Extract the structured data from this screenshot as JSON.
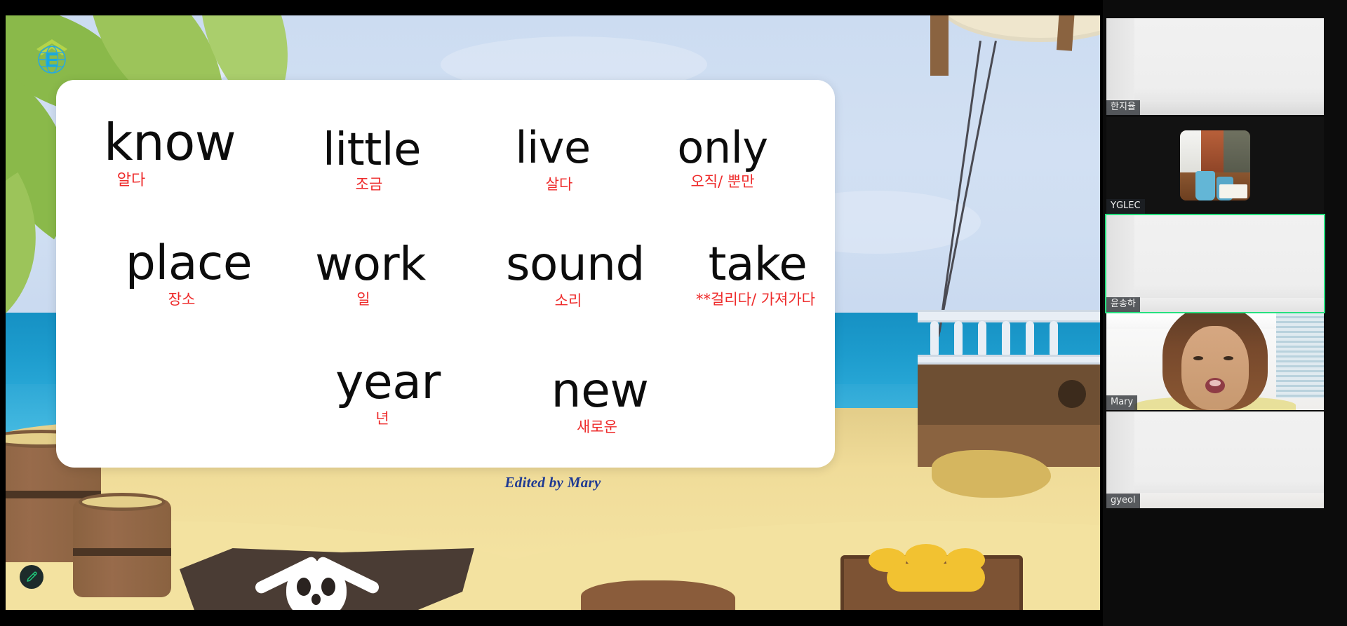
{
  "meeting": {
    "layout": "shared-screen-with-filmstrip",
    "active_speaker_border_color": "#26e07f",
    "annotate_button_label": "Annotate",
    "annotate_icon": "pencil-icon"
  },
  "slide": {
    "title_logo_alt": "globe-e-logo",
    "credit": "Edited by Mary",
    "credit_color": "#1f3a93",
    "background_theme": "pirate-beach",
    "word_color": "#0c0c0c",
    "translation_color": "#ee2b2b",
    "words": [
      {
        "en": "know",
        "ko": "알다"
      },
      {
        "en": "little",
        "ko": "조금"
      },
      {
        "en": "live",
        "ko": "살다"
      },
      {
        "en": "only",
        "ko": "오직/ 뿐만"
      },
      {
        "en": "place",
        "ko": "장소"
      },
      {
        "en": "work",
        "ko": "일"
      },
      {
        "en": "sound",
        "ko": "소리"
      },
      {
        "en": "take",
        "ko": "**걸리다/ 가져가다"
      },
      {
        "en": "year",
        "ko": "년"
      },
      {
        "en": "new",
        "ko": "새로운"
      }
    ]
  },
  "filmstrip": {
    "participants": [
      {
        "name": "한지율",
        "active": false,
        "feed": "wall"
      },
      {
        "name": "YGLEC",
        "active": false,
        "feed": "pip"
      },
      {
        "name": "윤송하",
        "active": true,
        "feed": "wall"
      },
      {
        "name": "Mary",
        "active": false,
        "feed": "person"
      },
      {
        "name": "gyeol",
        "active": false,
        "feed": "wall"
      }
    ]
  }
}
